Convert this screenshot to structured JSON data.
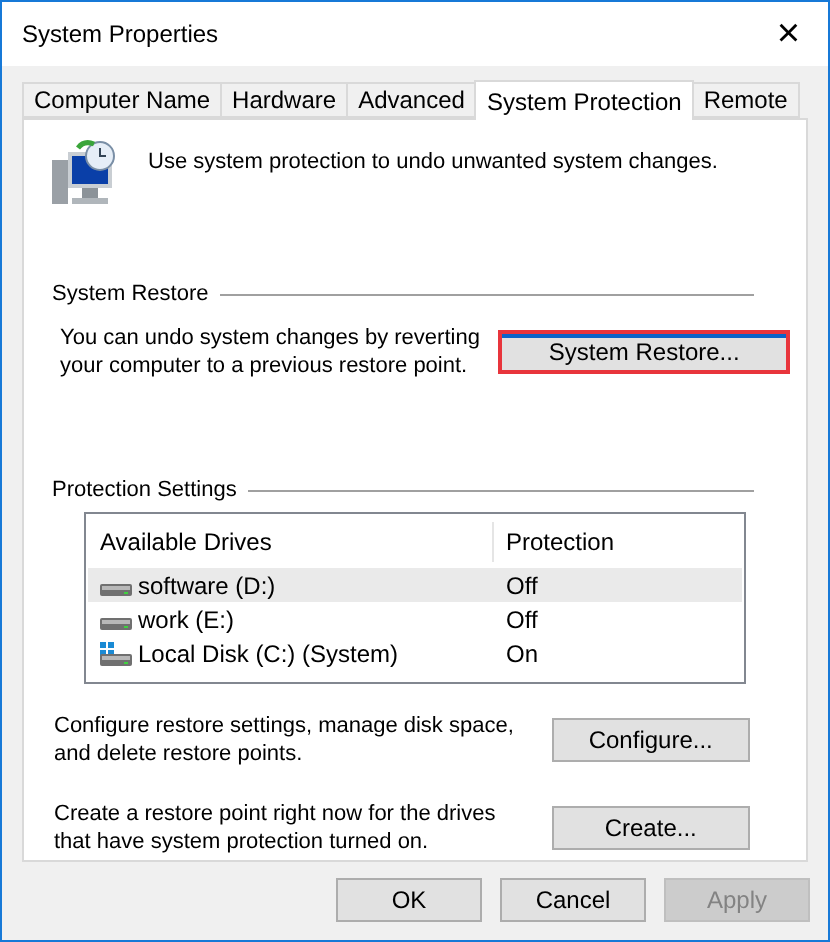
{
  "window": {
    "title": "System Properties",
    "close": "×"
  },
  "tabs": [
    {
      "label": "Computer Name",
      "selected": false
    },
    {
      "label": "Hardware",
      "selected": false
    },
    {
      "label": "Advanced",
      "selected": false
    },
    {
      "label": "System Protection",
      "selected": true
    },
    {
      "label": "Remote",
      "selected": false
    }
  ],
  "intro": "Use system protection to undo unwanted system changes.",
  "system_restore": {
    "heading": "System Restore",
    "text": "You can undo system changes by reverting your computer to a previous restore point.",
    "button": {
      "label": "System Restore...",
      "highlighted": true
    }
  },
  "protection_settings": {
    "heading": "Protection Settings",
    "columns": [
      "Available Drives",
      "Protection"
    ],
    "rows": [
      {
        "drive": "software (D:)",
        "protection": "Off",
        "kind": "data",
        "selected": true
      },
      {
        "drive": "work (E:)",
        "protection": "Off",
        "kind": "data",
        "selected": false
      },
      {
        "drive": "Local Disk (C:) (System)",
        "protection": "On",
        "kind": "system",
        "selected": false
      }
    ]
  },
  "actions": [
    {
      "text": "Configure restore settings, manage disk space, and delete restore points.",
      "button": "Configure..."
    },
    {
      "text": "Create a restore point right now for the drives that have system protection turned on.",
      "button": "Create..."
    }
  ],
  "buttons": [
    {
      "label": "OK",
      "disabled": false
    },
    {
      "label": "Cancel",
      "disabled": false
    },
    {
      "label": "Apply",
      "disabled": true
    }
  ]
}
